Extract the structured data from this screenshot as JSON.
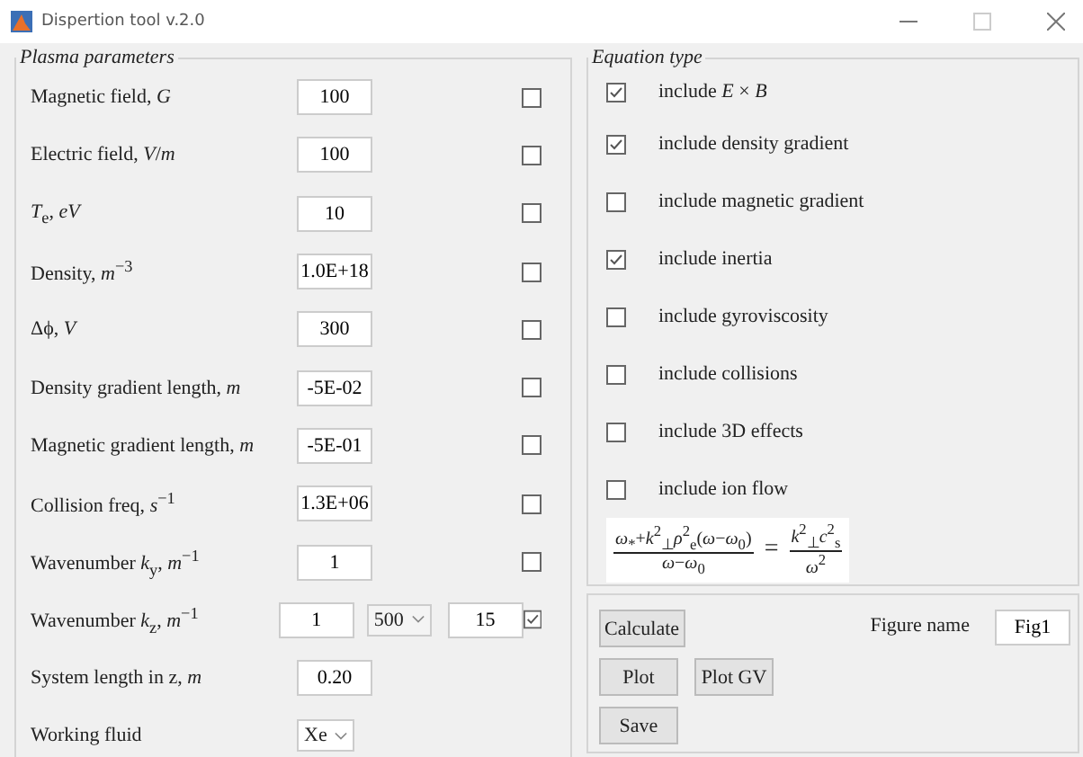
{
  "window": {
    "title": "Dispertion tool v.2.0"
  },
  "plasma_parameters": {
    "title": "Plasma parameters",
    "rows": [
      {
        "kind": "field",
        "label": "Magnetic field, *G*",
        "value": "100",
        "checked": false
      },
      {
        "kind": "field",
        "label": "Electric field, *V*/*m*",
        "value": "100",
        "checked": false
      },
      {
        "kind": "field",
        "label": "*T*$_{e}$, *eV*",
        "value": "10",
        "checked": false
      },
      {
        "kind": "field",
        "label": "Density, *m*$^{−3}$",
        "value": "1.0E+18",
        "checked": false
      },
      {
        "kind": "field",
        "label": "Δϕ, *V*",
        "value": "300",
        "checked": false
      },
      {
        "kind": "field",
        "label": "Density gradient length, *m*",
        "value": "-5E-02",
        "checked": false
      },
      {
        "kind": "field",
        "label": "Magnetic gradient length, *m*",
        "value": "-5E-01",
        "checked": false
      },
      {
        "kind": "field",
        "label": "Collision freq, *s*$^{−1}$",
        "value": "1.3E+06",
        "checked": false
      },
      {
        "kind": "field",
        "label": "Wavenumber *k*$_{y}$, *m*$^{−1}$",
        "value": "1",
        "checked": false
      },
      {
        "kind": "range",
        "label": "Wavenumber *k*$_{z}$, *m*$^{−1}$",
        "value": "1",
        "steps": "500",
        "value_2": "15",
        "checked": true
      },
      {
        "kind": "field",
        "label": "System length in z, *m*",
        "value": "0.20"
      },
      {
        "kind": "dropdown",
        "label": "Working fluid",
        "value": "Xe"
      }
    ]
  },
  "equation_type": {
    "title": "Equation type",
    "options": [
      {
        "label": "include *E* × *B*",
        "checked": true
      },
      {
        "label": "include density gradient",
        "checked": true
      },
      {
        "label": "include magnetic gradient",
        "checked": false
      },
      {
        "label": "include inertia",
        "checked": true
      },
      {
        "label": "include gyroviscosity",
        "checked": false
      },
      {
        "label": "include collisions",
        "checked": false
      },
      {
        "label": "include 3D effects",
        "checked": false
      },
      {
        "label": "include ion flow",
        "checked": false
      }
    ],
    "equation": {
      "lhs_numerator": "*ω*$_{*}$+*k*$^{2}$$_{⊥}$*ρ*$^{2}$$_{e}$(*ω*−*ω*$_{0}$)",
      "lhs_denominator": "*ω*−*ω*$_{0}$",
      "equals": "=",
      "rhs_numerator": "*k*$^{2}$$_{⊥}$*c*$^{2}$$_{s}$",
      "rhs_denominator": "*ω*$^{2}$"
    }
  },
  "actions": {
    "buttons": [
      {
        "kind": "calculate",
        "label": "Calculate"
      },
      {
        "kind": "plot",
        "label": "Plot"
      },
      {
        "kind": "plot",
        "label": "Plot GV"
      },
      {
        "kind": "save",
        "label": "Save"
      }
    ],
    "figure_name": {
      "label": "Figure name",
      "value": "Fig1"
    }
  }
}
